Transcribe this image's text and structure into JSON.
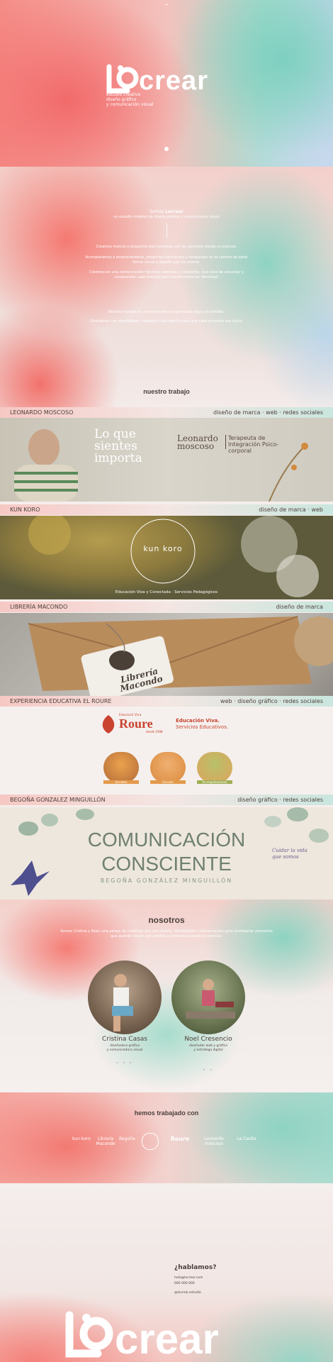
{
  "hero": {
    "logo": "locrear",
    "tagline": [
      "estudio creativo",
      "diseño gráfico",
      "y comunicación visual"
    ]
  },
  "manifesto": {
    "title_prefix": "Somos ",
    "title_emphasis": "Locrear",
    "subtitle": "un estudio creativo de diseño gráfico y comunicación visual",
    "p1": "Creamos marcas y proyectos que conectan con las personas desde su esencia.",
    "p2": "Acompañamos a emprendedoras, proyectos educativos y terapeutas en el camino de darle forma visual a aquello que les mueve.",
    "p3": "Creemos en una comunicación honesta, cercana y consciente, que nace de escuchar y comprender cada historia para transformarla en identidad.",
    "p4": "Nuestro trabajo es una invitación a crear juntas algo con sentido.",
    "p5": "Diseñamos con sensibilidad, cuidando cada detalle para que cada proyecto sea único."
  },
  "work_title": "nuestro trabajo",
  "projects": [
    {
      "name": "LEONARDO MOSCOSO",
      "tags": "diseño de marca · web · redes sociales",
      "quote": "Lo que sientes importa",
      "brand": "Leonardo moscoso",
      "desc": "Terapeuta de Integración Psico-corporal"
    },
    {
      "name": "KUN KORO",
      "tags": "diseño de marca · web",
      "brand": "kun koro",
      "caption": "Educación Viva y Conectada · Servicios Pedagógicos"
    },
    {
      "name": "LIBRERÍA MACONDO",
      "tags": "diseño de marca",
      "brand": "Librería Macondo"
    },
    {
      "name": "EXPERIENCIA EDUCATIVA EL ROURE",
      "tags": "web · diseño gráfico · redes sociales",
      "brand_small": "Educació Viva",
      "brand": "Roure",
      "brand_since": "desde 1998",
      "headline_1": "Educación Viva.",
      "headline_2": "Servicios Educativos.",
      "cards": [
        "Escoleta",
        "Escuela",
        "Acompañamiento"
      ]
    },
    {
      "name": "BEGOÑA GONZALEZ MINGUILLÓN",
      "tags": "diseño gráfico · redes sociales",
      "line1": "COMUNICACIÓN",
      "line2": "CONSCIENTE",
      "author": "BEGOÑA GONZÁLEZ MINGUILLÓN",
      "script": "Cuidar la vida que somos"
    }
  ],
  "nosotros": {
    "title": "nosotros",
    "intro": "Somos Cristina y Noel, una pareja de creativas que une diseño, sensibilidad y comunicación para acompañar proyectos que quieren crecer con sentido y coherencia desde su esencia.",
    "people": [
      {
        "name": "Cristina Casas",
        "role_1": "diseñadora gráfica",
        "role_2": "y comunicadora visual",
        "socials": "◦ ◦ ◦"
      },
      {
        "name": "Noel Cresencio",
        "role_1": "diseñador web y gráfico",
        "role_2": "y estratega digital",
        "socials": "◦ ◦"
      }
    ]
  },
  "clients": {
    "title": "hemos trabajado con",
    "logos": [
      "kun koro",
      "Librería Macondo",
      "Begoña",
      "Roure",
      "Leonardo moscoso",
      "La Casita"
    ]
  },
  "contact": {
    "title": "¿hablamos?",
    "email": "hola@locrear.com",
    "phone": "600 000 000",
    "instagram": "@locrear.estudio"
  },
  "footer_logo": "locrear",
  "colors": {
    "coral": "#f26b6b",
    "mint": "#7ed0c0",
    "sky": "#c6d8ec",
    "text": "#4d3f3b"
  }
}
